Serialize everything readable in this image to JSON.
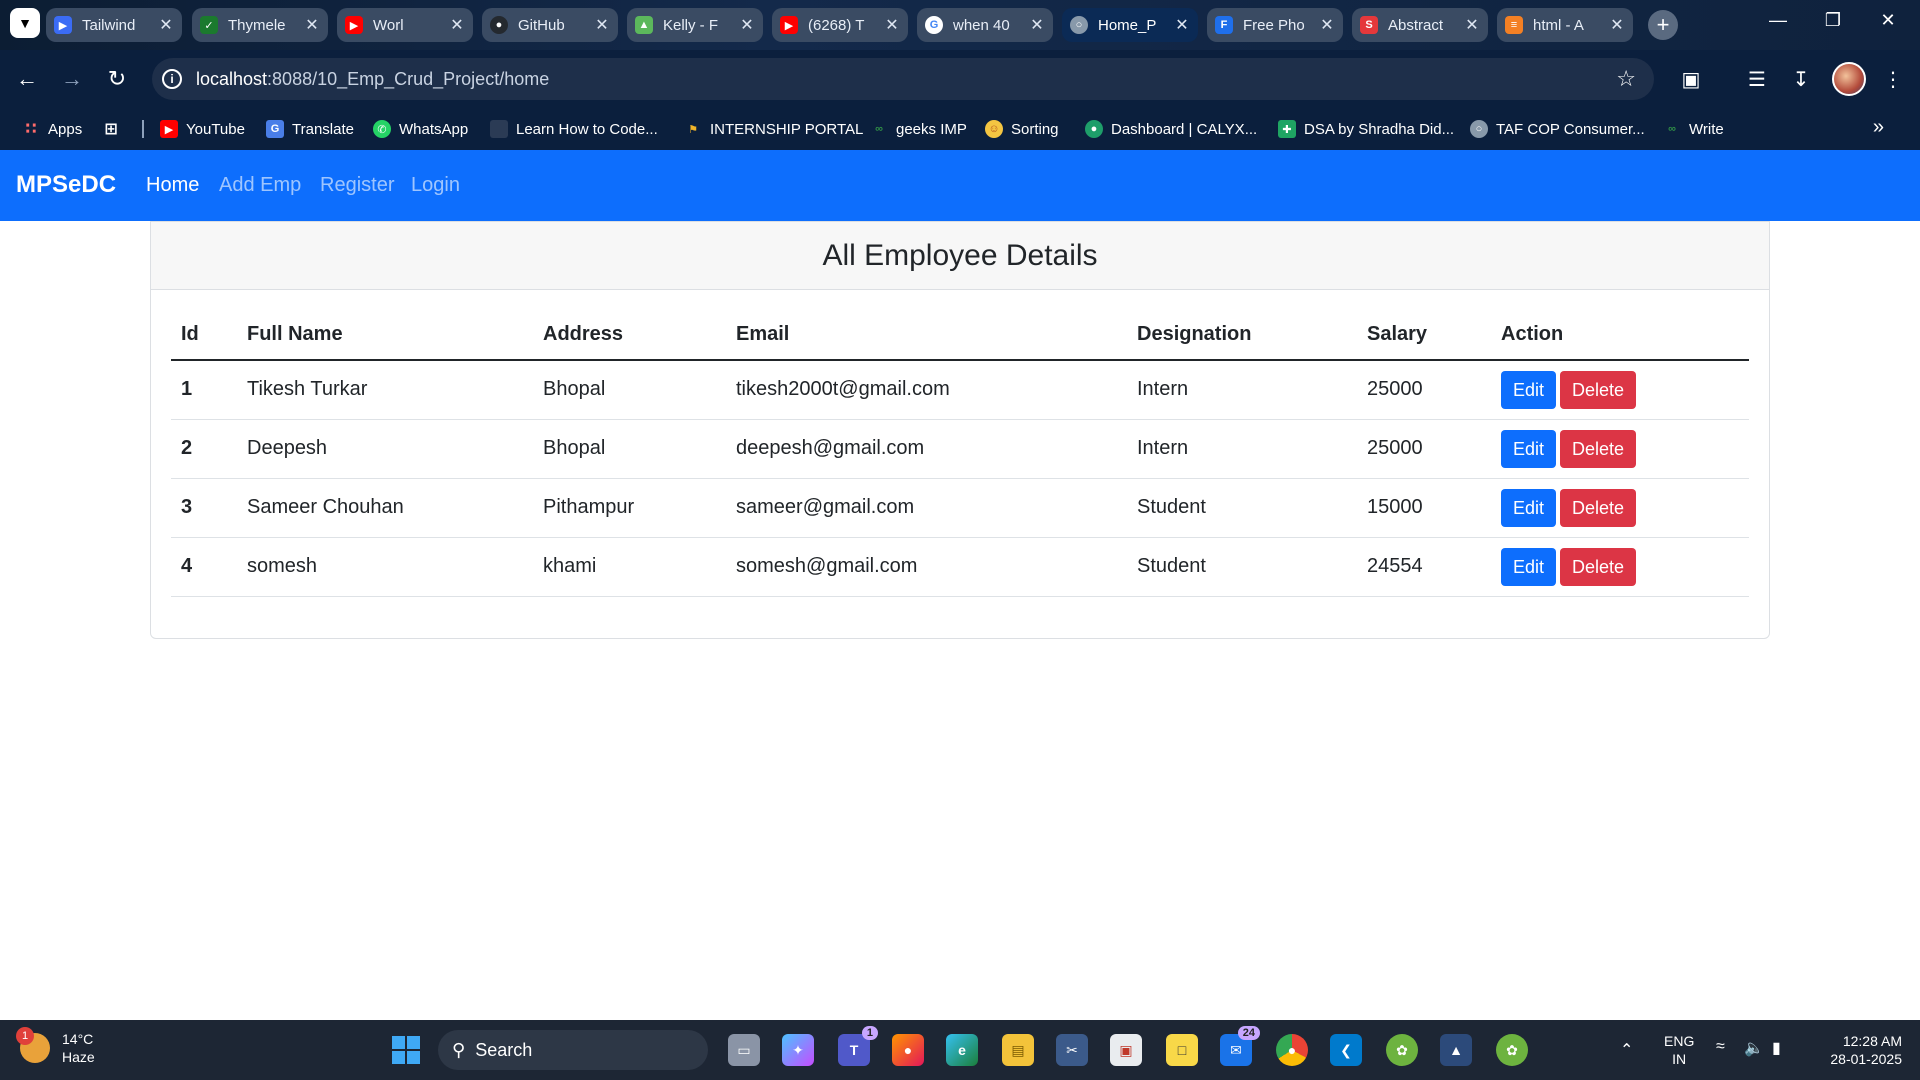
{
  "browser": {
    "tabs": [
      {
        "title": "Tailwind",
        "icon": "tailwind-icon",
        "color": "#3b6cf5"
      },
      {
        "title": "Thymele",
        "icon": "thymeleaf-icon",
        "color": "#1b7a2e"
      },
      {
        "title": "Worl",
        "icon": "youtube-icon",
        "color": "#ff0000"
      },
      {
        "title": "GitHub",
        "icon": "github-icon",
        "color": "#24292f"
      },
      {
        "title": "Kelly - F",
        "icon": "kelly-icon",
        "color": "#5cb85c"
      },
      {
        "title": "(6268) T",
        "icon": "youtube-icon",
        "color": "#ff0000"
      },
      {
        "title": "when 40",
        "icon": "google-icon",
        "color": "#4285f4"
      },
      {
        "title": "Home_P",
        "icon": "globe-icon",
        "color": "#8899aa"
      },
      {
        "title": "Free Pho",
        "icon": "freepik-icon",
        "color": "#1f6feb"
      },
      {
        "title": "Abstract",
        "icon": "abstract-icon",
        "color": "#e5383b"
      },
      {
        "title": "html - A",
        "icon": "stackoverflow-icon",
        "color": "#f48024"
      }
    ],
    "active_tab": 7,
    "url_host": "localhost",
    "url_rest": ":8088/10_Emp_Crud_Project/home",
    "bookmarks": [
      {
        "label": "Apps",
        "icon": "apps-grid-icon"
      },
      {
        "label": "YouTube",
        "icon": "youtube-icon"
      },
      {
        "label": "Translate",
        "icon": "translate-icon"
      },
      {
        "label": "WhatsApp",
        "icon": "whatsapp-icon"
      },
      {
        "label": "Learn How to Code...",
        "icon": "doc-icon"
      },
      {
        "label": "INTERNSHIP PORTAL",
        "icon": "portal-icon"
      },
      {
        "label": "geeks IMP",
        "icon": "gfg-icon"
      },
      {
        "label": "Sorting",
        "icon": "sorting-icon"
      },
      {
        "label": "Dashboard | CALYX...",
        "icon": "calyx-icon"
      },
      {
        "label": "DSA by Shradha Did...",
        "icon": "sheets-icon"
      },
      {
        "label": "TAF COP Consumer...",
        "icon": "globe-icon"
      },
      {
        "label": "Write",
        "icon": "gfg-icon"
      }
    ]
  },
  "app": {
    "brand": "MPSeDC",
    "nav": [
      "Home",
      "Add Emp",
      "Register",
      "Login"
    ],
    "active_nav": "Home",
    "colors": {
      "navbar": "#0d6efd",
      "edit": "#0d6efd",
      "delete": "#dc3545"
    }
  },
  "card": {
    "title": "All Employee Details",
    "columns": [
      "Id",
      "Full Name",
      "Address",
      "Email",
      "Designation",
      "Salary",
      "Action"
    ],
    "rows": [
      {
        "id": "1",
        "name": "Tikesh Turkar",
        "address": "Bhopal",
        "email": "tikesh2000t@gmail.com",
        "designation": "Intern",
        "salary": "25000"
      },
      {
        "id": "2",
        "name": "Deepesh",
        "address": "Bhopal",
        "email": "deepesh@gmail.com",
        "designation": "Intern",
        "salary": "25000"
      },
      {
        "id": "3",
        "name": "Sameer Chouhan",
        "address": "Pithampur",
        "email": "sameer@gmail.com",
        "designation": "Student",
        "salary": "15000"
      },
      {
        "id": "4",
        "name": "somesh",
        "address": "khami",
        "email": "somesh@gmail.com",
        "designation": "Student",
        "salary": "24554"
      }
    ],
    "edit_label": "Edit",
    "delete_label": "Delete"
  },
  "taskbar": {
    "weather_temp": "14°C",
    "weather_desc": "Haze",
    "weather_badge": "1",
    "search_label": "Search",
    "teams_badge": "1",
    "mail_badge": "24",
    "lang": "ENG",
    "region": "IN",
    "time": "12:28 AM",
    "date": "28-01-2025"
  }
}
